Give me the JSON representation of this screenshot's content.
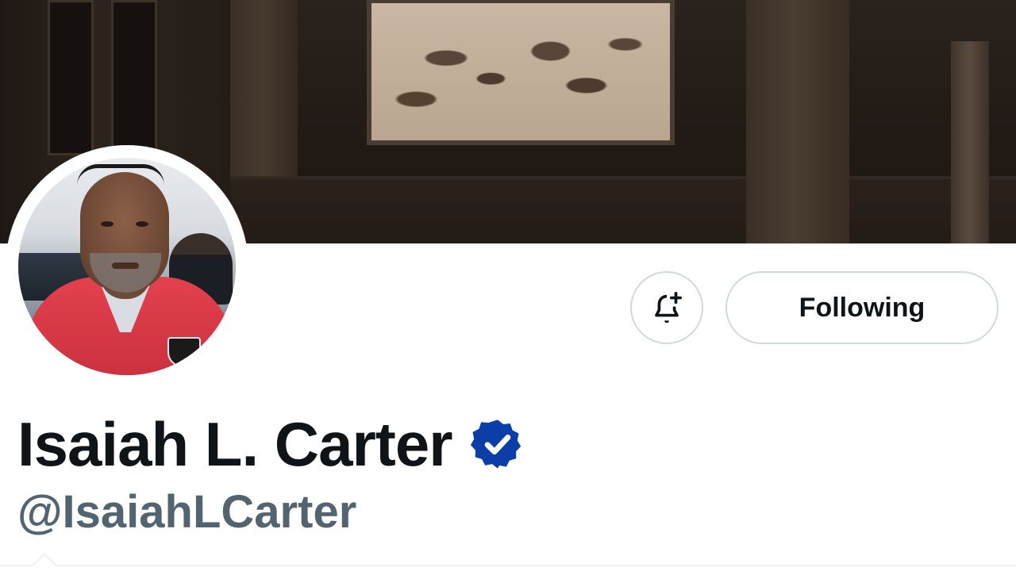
{
  "profile": {
    "display_name": "Isaiah L. Carter",
    "handle": "@IsaiahLCarter",
    "verified": true
  },
  "actions": {
    "notify_icon": "bell-plus-icon",
    "follow_label": "Following"
  },
  "colors": {
    "text_primary": "#0f1419",
    "text_secondary": "#536471",
    "verified_badge": "#0b3ea8",
    "button_border": "#cfd9de",
    "banner_dark": "#211a15"
  }
}
